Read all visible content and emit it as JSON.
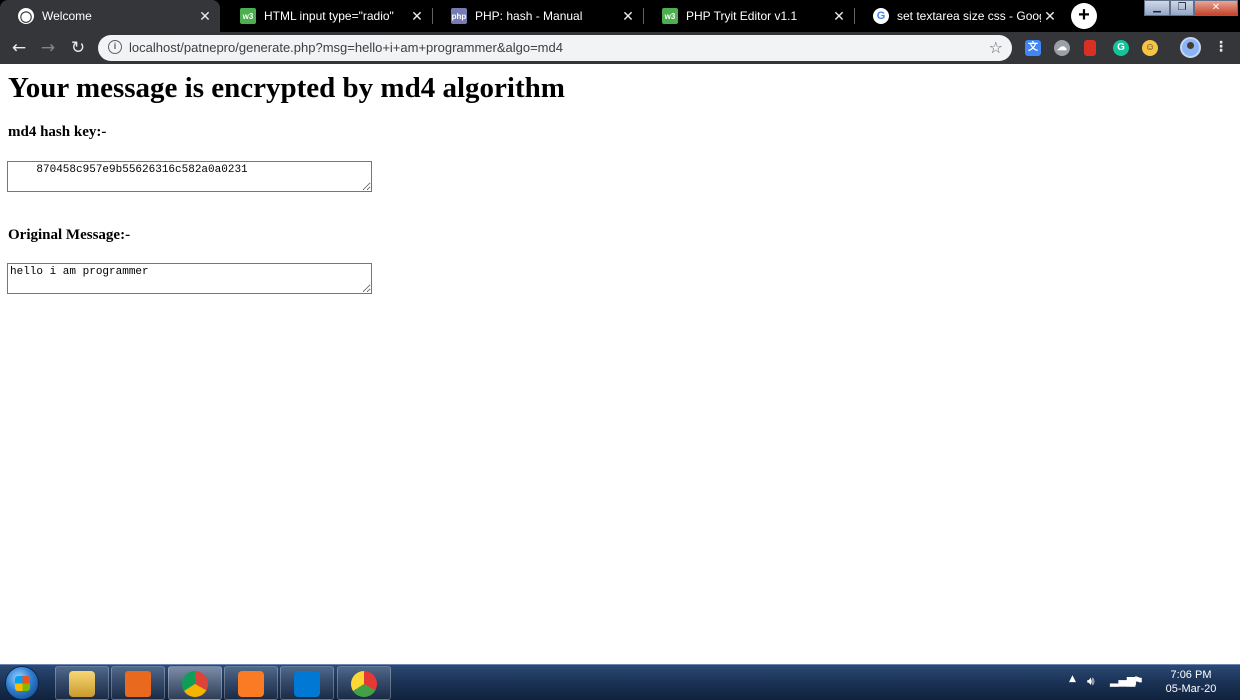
{
  "browser": {
    "tabs": [
      {
        "title": "Welcome",
        "favicon": "globe-icon",
        "active": true
      },
      {
        "title": "HTML input type=\"radio\"",
        "favicon": "w3schools-icon",
        "active": false
      },
      {
        "title": "PHP: hash - Manual",
        "favicon": "php-icon",
        "active": false
      },
      {
        "title": "PHP Tryit Editor v1.1",
        "favicon": "w3schools-icon",
        "active": false
      },
      {
        "title": "set textarea size css - Google S",
        "favicon": "google-icon",
        "active": false
      }
    ],
    "url": "localhost/patnepro/generate.php?msg=hello+i+am+programmer&algo=md4"
  },
  "page": {
    "heading": "Your message is encrypted by md4 algorithm",
    "hash_label": "md4 hash key:-",
    "hash_value": "    870458c957e9b55626316c582a0a0231",
    "original_label": "Original Message:-",
    "original_value": "hello i am programmer"
  },
  "taskbar": {
    "time": "7:06 PM",
    "date": "05-Mar-20"
  },
  "colors": {
    "tab_strip": "#000000",
    "toolbar": "#35363a",
    "omnibox": "#f1f3f4",
    "taskbar": "#1c3458"
  }
}
